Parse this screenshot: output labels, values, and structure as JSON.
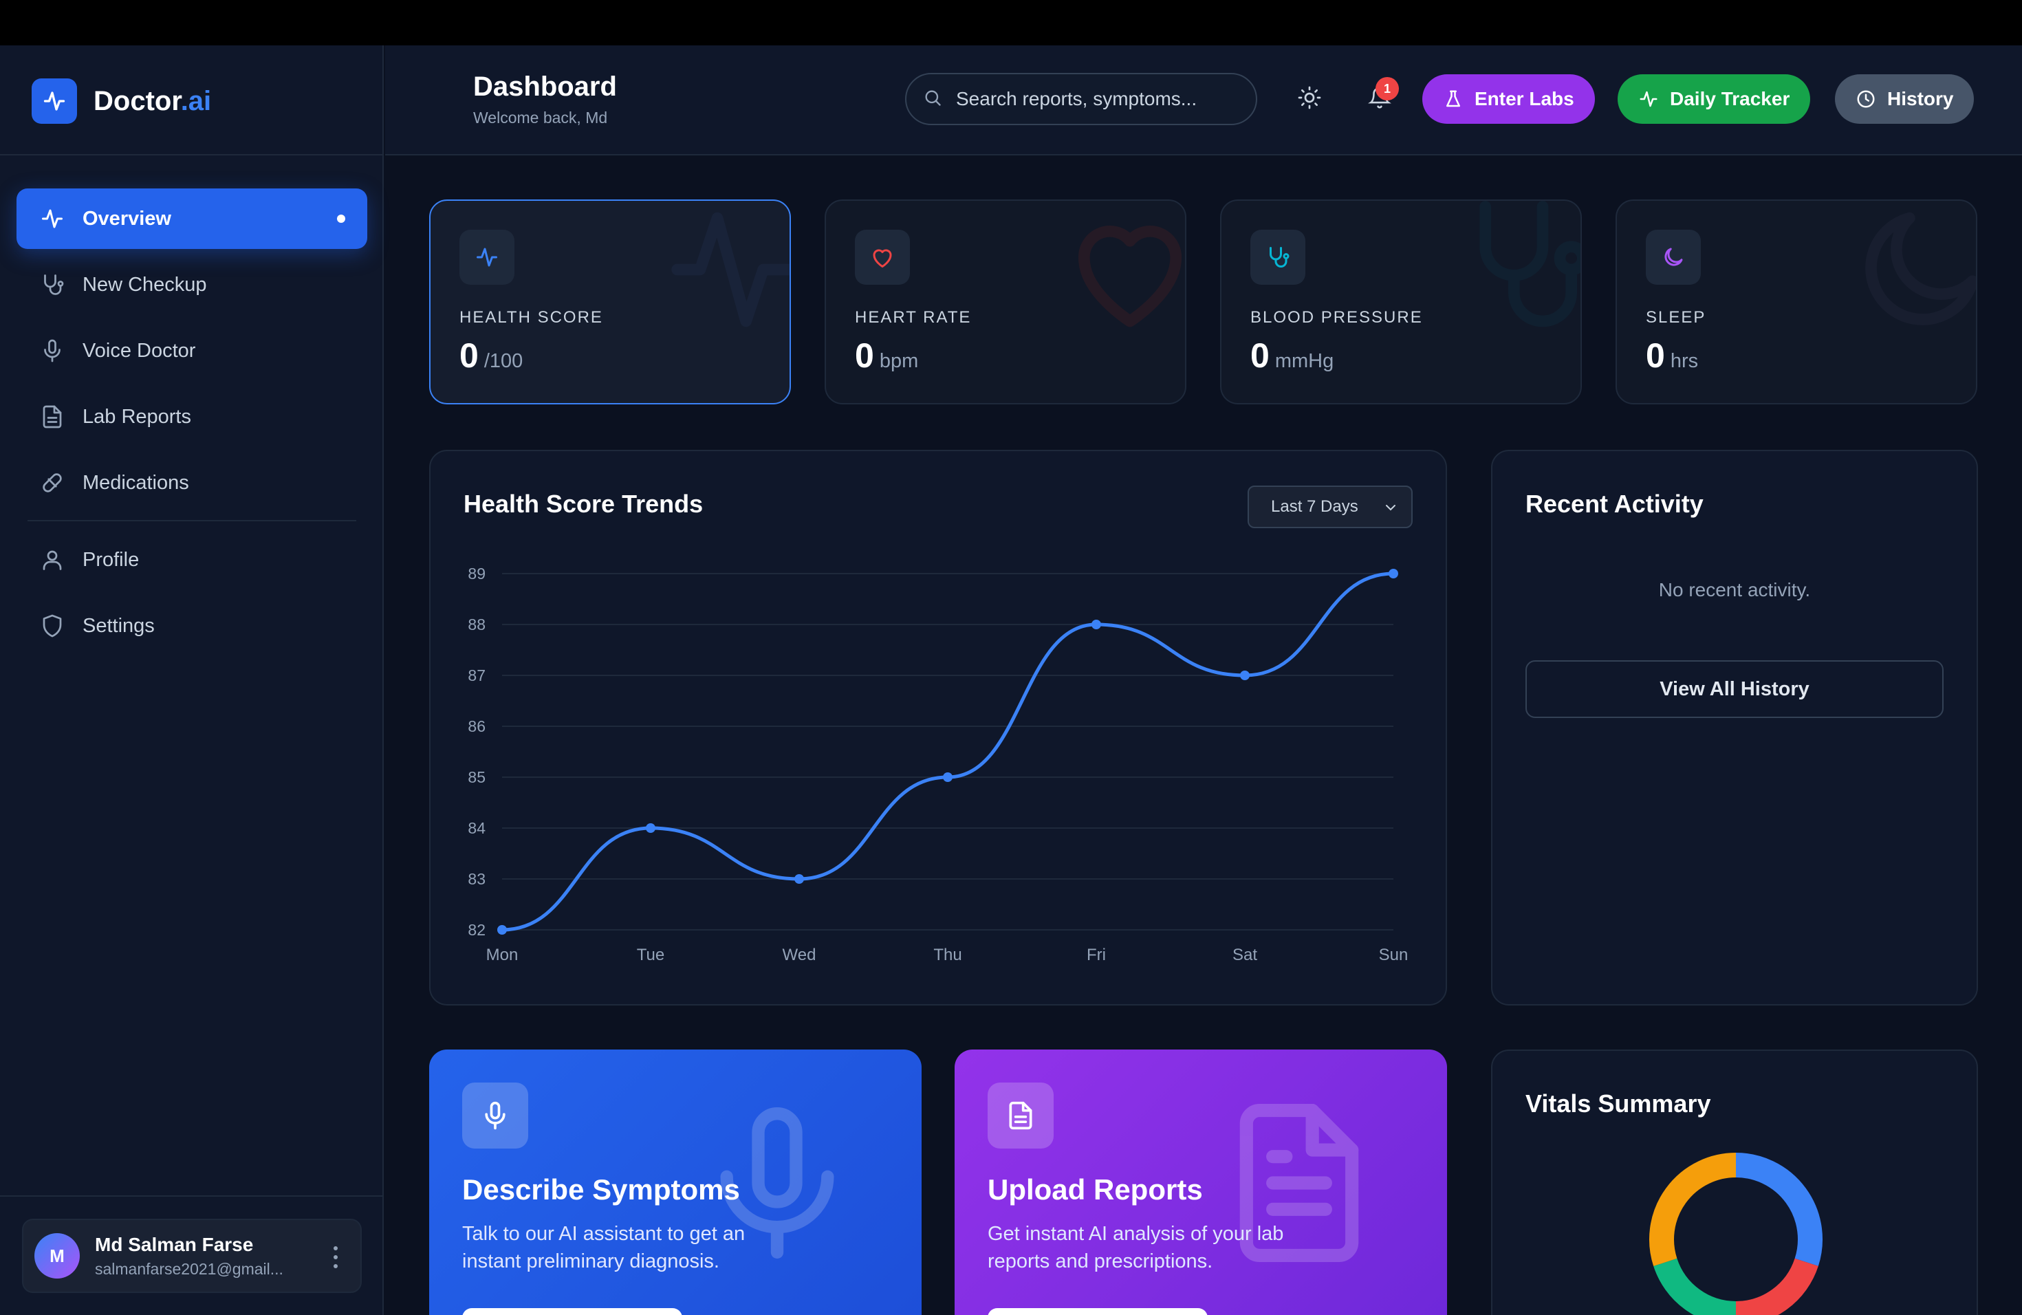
{
  "brand": {
    "name": "Doctor",
    "suffix": ".ai"
  },
  "sidebar": {
    "items": [
      {
        "label": "Overview",
        "icon": "activity-icon",
        "active": true
      },
      {
        "label": "New Checkup",
        "icon": "stethoscope-icon"
      },
      {
        "label": "Voice Doctor",
        "icon": "microphone-icon"
      },
      {
        "label": "Lab Reports",
        "icon": "document-icon"
      },
      {
        "label": "Medications",
        "icon": "pill-icon"
      },
      {
        "label": "Profile",
        "icon": "user-icon"
      },
      {
        "label": "Settings",
        "icon": "shield-icon"
      }
    ],
    "user": {
      "initial": "M",
      "name": "Md Salman Farse",
      "email": "salmanfarse2021@gmail..."
    }
  },
  "header": {
    "title": "Dashboard",
    "subtitle": "Welcome back, Md",
    "search_placeholder": "Search reports, symptoms...",
    "notification_count": "1",
    "buttons": {
      "labs": "Enter Labs",
      "tracker": "Daily Tracker",
      "history": "History"
    }
  },
  "stats": [
    {
      "title": "HEALTH SCORE",
      "value": "0",
      "unit": "/100",
      "icon": "activity-icon",
      "color": "#3b82f6"
    },
    {
      "title": "HEART RATE",
      "value": "0",
      "unit": "bpm",
      "icon": "heart-icon",
      "color": "#ef4444"
    },
    {
      "title": "BLOOD PRESSURE",
      "value": "0",
      "unit": "mmHg",
      "icon": "stethoscope-icon",
      "color": "#06b6d4"
    },
    {
      "title": "SLEEP",
      "value": "0",
      "unit": "hrs",
      "icon": "moon-icon",
      "color": "#a855f7"
    }
  ],
  "trends": {
    "title": "Health Score Trends",
    "range_selected": "Last 7 Days"
  },
  "chart_data": {
    "type": "line",
    "title": "Health Score Trends",
    "categories": [
      "Mon",
      "Tue",
      "Wed",
      "Thu",
      "Fri",
      "Sat",
      "Sun"
    ],
    "series": [
      {
        "values": [
          82,
          84,
          83,
          85,
          88,
          87,
          89
        ]
      }
    ],
    "ylim": [
      82,
      89
    ],
    "yticks": [
      82,
      83,
      84,
      85,
      86,
      87,
      88,
      89
    ],
    "grid": true,
    "color": "#3b82f6"
  },
  "activity": {
    "title": "Recent Activity",
    "empty": "No recent activity.",
    "button": "View All History"
  },
  "actions": [
    {
      "title": "Describe Symptoms",
      "desc": "Talk to our AI assistant to get an instant preliminary diagnosis.",
      "icon": "microphone-icon"
    },
    {
      "title": "Upload Reports",
      "desc": "Get instant AI analysis of your lab reports and prescriptions.",
      "icon": "document-icon"
    }
  ],
  "vitals": {
    "title": "Vitals Summary",
    "segments": [
      {
        "color": "#3b82f6",
        "value": 0.3
      },
      {
        "color": "#ef4444",
        "value": 0.2
      },
      {
        "color": "#10b981",
        "value": 0.2
      },
      {
        "color": "#f59e0b",
        "value": 0.3
      }
    ]
  }
}
